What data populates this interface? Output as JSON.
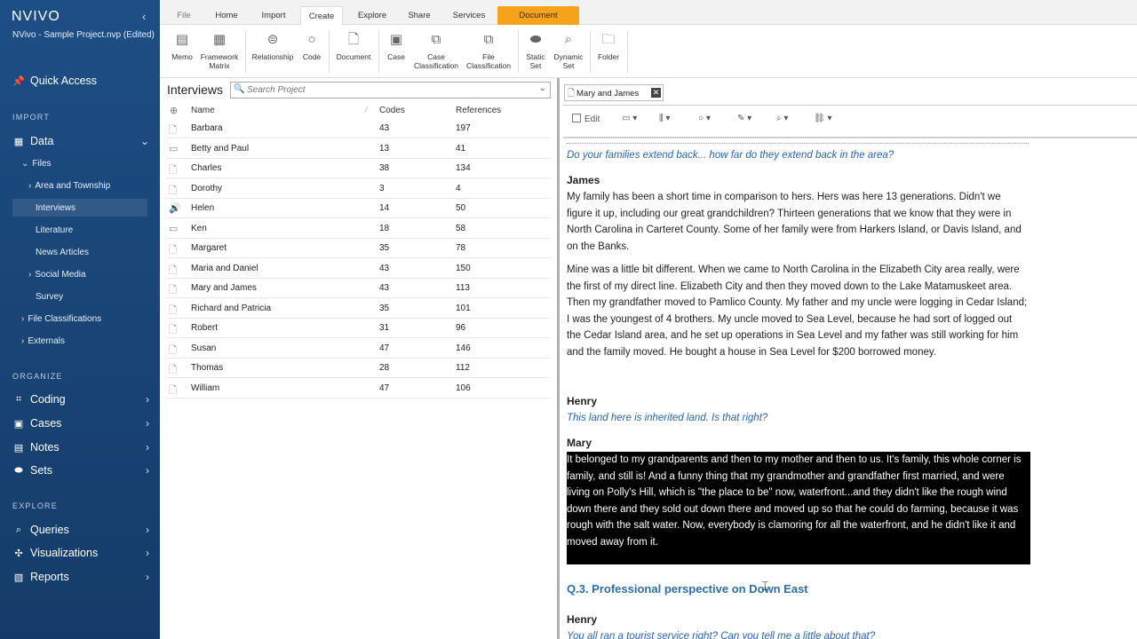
{
  "app": {
    "brand": "NVIVO",
    "project": "NVivo - Sample Project.nvp (Edited)"
  },
  "sidebar": {
    "quick_access": "Quick Access",
    "import_heading": "IMPORT",
    "data": "Data",
    "files": "Files",
    "area_township": "Area and Township",
    "interviews": "Interviews",
    "literature": "Literature",
    "news_articles": "News Articles",
    "social_media": "Social Media",
    "survey": "Survey",
    "file_classifications": "File Classifications",
    "externals": "Externals",
    "organize_heading": "ORGANIZE",
    "coding": "Coding",
    "cases": "Cases",
    "notes": "Notes",
    "sets": "Sets",
    "explore_heading": "EXPLORE",
    "queries": "Queries",
    "visualizations": "Visualizations",
    "reports": "Reports"
  },
  "ribbon": {
    "tabs": [
      "File",
      "Home",
      "Import",
      "Create",
      "Explore",
      "Share",
      "Services",
      "Document"
    ],
    "buttons": {
      "memo": "Memo",
      "framework_1": "Framework",
      "framework_2": "Matrix",
      "relationship": "Relationship",
      "code": "Code",
      "document": "Document",
      "case": "Case",
      "case_class_1": "Case",
      "case_class_2": "Classification",
      "file_class_1": "File",
      "file_class_2": "Classification",
      "static_1": "Static",
      "static_2": "Set",
      "dynamic_1": "Dynamic",
      "dynamic_2": "Set",
      "folder": "Folder"
    }
  },
  "list": {
    "title": "Interviews",
    "search_placeholder": "Search Project",
    "columns": {
      "name": "Name",
      "codes": "Codes",
      "references": "References"
    },
    "rows": [
      {
        "name": "Barbara",
        "codes": "43",
        "refs": "197"
      },
      {
        "name": "Betty and Paul",
        "codes": "13",
        "refs": "41"
      },
      {
        "name": "Charles",
        "codes": "38",
        "refs": "134"
      },
      {
        "name": "Dorothy",
        "codes": "3",
        "refs": "4"
      },
      {
        "name": "Helen",
        "codes": "14",
        "refs": "50"
      },
      {
        "name": "Ken",
        "codes": "18",
        "refs": "58"
      },
      {
        "name": "Margaret",
        "codes": "35",
        "refs": "78"
      },
      {
        "name": "Maria and Daniel",
        "codes": "43",
        "refs": "150"
      },
      {
        "name": "Mary and James",
        "codes": "43",
        "refs": "113"
      },
      {
        "name": "Richard and Patricia",
        "codes": "35",
        "refs": "101"
      },
      {
        "name": "Robert",
        "codes": "31",
        "refs": "96"
      },
      {
        "name": "Susan",
        "codes": "47",
        "refs": "146"
      },
      {
        "name": "Thomas",
        "codes": "28",
        "refs": "112"
      },
      {
        "name": "William",
        "codes": "47",
        "refs": "106"
      }
    ]
  },
  "document": {
    "tab_title": "Mary and James",
    "edit_label": "Edit",
    "q1": "Do your families extend back... how far do they extend back in the area?",
    "speaker_james": "James",
    "p1": "My family has been a short time in comparison to hers. Hers was here 13 generations. Didn't we figure it up, including our great grandchildren? Thirteen generations that we know that they were in North Carolina in Carteret County. Some of her family were from Harkers Island, or Davis Island, and on the Banks.",
    "p2": "Mine was a little bit different. When we came to North Carolina in the Elizabeth City area really, were the first of my direct line. Elizabeth City and then they moved down to the Lake Matamuskeet area. Then my grandfather moved to Pamlico County.  My father and my uncle were logging in Cedar Island; I was the youngest of 4 brothers. My uncle moved to Sea Level, because he had sort of logged out the Cedar Island area, and he set up operations in Sea Level and my father was still working for him and the family moved. He bought a house in Sea Level for $200 borrowed money.",
    "speaker_henry": "Henry",
    "q2": "This land here is inherited land. Is that right?",
    "speaker_mary": "Mary",
    "p3": "It belonged to my grandparents and then to my mother and then to us. It's family, this whole corner is family, and still is! And a funny thing that my grandmother and grandfather first married, and were living on Polly's Hill, which is \"the place to be\" now, waterfront...and they didn't like the rough wind down there and they sold out down there and moved up so that he could do farming, because it was rough with the salt water. Now, everybody is clamoring for all the waterfront, and he didn't like it and moved away from it.",
    "section": "Q.3. Professional perspective on Down East",
    "speaker_henry2": "Henry",
    "q3": "You all ran a tourist service right? Can you tell me a little about that?"
  }
}
